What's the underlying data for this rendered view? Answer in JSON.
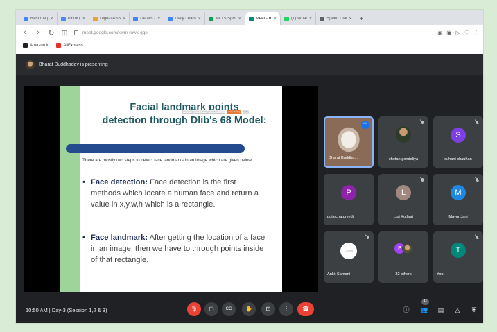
{
  "browser": {
    "tabs": [
      {
        "label": "Resume |",
        "favicon_color": "#4285f4",
        "active": false
      },
      {
        "label": "Inbox (",
        "favicon_color": "#4a8af4",
        "active": false
      },
      {
        "label": "Digital ASS",
        "favicon_color": "#e8a33d",
        "active": false
      },
      {
        "label": "Details -",
        "favicon_color": "#4285f4",
        "active": false
      },
      {
        "label": "Daily Learn",
        "favicon_color": "#4285f4",
        "active": false
      },
      {
        "label": "ML1S Sprd",
        "favicon_color": "#0f9d58",
        "active": false
      },
      {
        "label": "Meet - R",
        "favicon_color": "#00897b",
        "active": true
      },
      {
        "label": "(1) What",
        "favicon_color": "#25d366",
        "active": false
      },
      {
        "label": "Speed Dial",
        "favicon_color": "#5f6368",
        "active": false
      }
    ],
    "new_tab": "+",
    "url": "meet.google.com/xwm-rnwk-qqe",
    "bookmarks": [
      {
        "label": "Amazon.in",
        "icon_color": "#222222"
      },
      {
        "label": "AliExpress",
        "icon_color": "#e43225"
      }
    ]
  },
  "meet": {
    "presenter_text": "Bharat Buddhadev is presenting",
    "slide": {
      "title_line1": "Facial landmark points",
      "title_line2": "detection through Dlib's 68 Model:",
      "share_notice": "meet.google.com is sharing a window",
      "stop_sharing": "Stop sharing",
      "hide": "Hide",
      "intro": "There are mostly two steps to detect face landmarks in an image which are given below:",
      "point1_head": "Face detection:",
      "point1_body": " Face detection is the first methods which locate a human face and return a value in x,y,w,h which is a rectangle.",
      "point2_head": "Face landmark:",
      "point2_body": " After getting the location of a face in an image, then we have to through points inside of that rectangle."
    },
    "participants": [
      {
        "name": "Bharat Buddha...",
        "type": "photo",
        "speaking": true
      },
      {
        "name": "chetan gondaliya",
        "type": "photo-small",
        "muted": true
      },
      {
        "name": "suhani chauhan",
        "initial": "S",
        "color": "#7b3fe4",
        "muted": true
      },
      {
        "name": "puja chaturvedi",
        "initial": "P",
        "color": "#8e24aa",
        "muted": false
      },
      {
        "name": "Lipi Kothari",
        "initial": "L",
        "color": "#a1887f",
        "muted": true
      },
      {
        "name": "Mayur Jani",
        "initial": "M",
        "color": "#1e88e5",
        "muted": true
      },
      {
        "name": "Ankit Samani",
        "type": "logo",
        "logo_text": "CEOW",
        "muted": true
      },
      {
        "name": "32 others",
        "type": "stack",
        "initial": "P",
        "muted": false
      },
      {
        "name": "You",
        "initial": "T",
        "color": "#00897b",
        "muted": true
      }
    ],
    "bottom": {
      "time": "10:50 AM",
      "separator": "|",
      "meeting_name": "Day-3 (Session 1,2 & 3)",
      "participant_count": "41"
    }
  }
}
